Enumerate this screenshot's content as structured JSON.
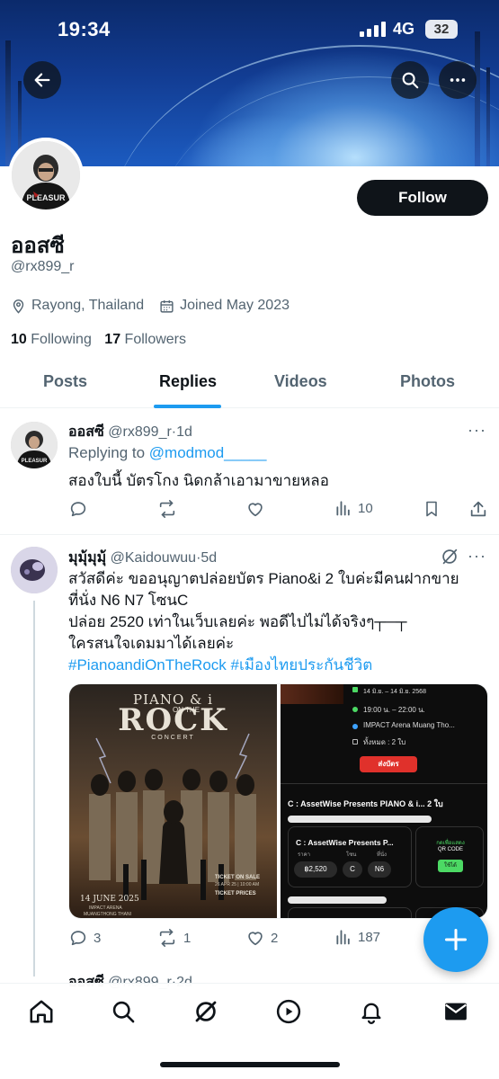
{
  "status_bar": {
    "time": "19:34",
    "network": "4G",
    "battery": "32"
  },
  "profile": {
    "display_name": "ออสซี",
    "handle": "@rx899_r",
    "location": "Rayong, Thailand",
    "joined": "Joined May 2023",
    "following_count": "10",
    "following_label": "Following",
    "followers_count": "17",
    "followers_label": "Followers",
    "follow_label": "Follow"
  },
  "tabs": [
    {
      "label": "Posts",
      "active": false
    },
    {
      "label": "Replies",
      "active": true
    },
    {
      "label": "Videos",
      "active": false
    },
    {
      "label": "Photos",
      "active": false
    }
  ],
  "posts": [
    {
      "name": "ออสซี",
      "handle": "@rx899_r",
      "time": "1d",
      "replying_prefix": "Replying to ",
      "replying_to": "@modmod_____",
      "text": "สองใบนี้ บัตรโกง นิดกล้าเอามาขายหลอ",
      "views": "10"
    },
    {
      "name": "มุมุ้มุมุ้",
      "handle": "@Kaidouwuu",
      "time": "5d",
      "lines": [
        "สวัสดีค่ะ ขออนุญาตปล่อยบัตร Piano&i 2 ใบค่ะมีคนฝากขาย",
        "ที่นั่ง N6 N7 โซนC",
        "ปล่อย 2520 เท่าในเว็บเลยค่ะ พอดีไปไม่ได้จริงๆ┬─┬",
        "ใครสนใจเดมมาได้เลยค่ะ"
      ],
      "hashtags": "#PianoandiOnTheRock #เมืองไทยประกันชีวิต",
      "replies": "3",
      "reposts": "1",
      "likes": "2",
      "views": "187",
      "poster": {
        "title_top": "PIANO & i",
        "on_the": "ON THE",
        "title_main": "ROCK",
        "concert": "CONCERT",
        "date": "14 JUNE 2025",
        "venue": "IMPACT ARENA",
        "venue2": "MUANGTHONG THANI",
        "sale_title": "TICKET ON SALE",
        "sale_date": "26 APR 25 | 10:00 AM",
        "prices_title": "TICKET PRICES"
      },
      "ticket": {
        "date": "14 มิ.ย. – 14 มิ.ย. 2568",
        "time": "19:00 น. – 22:00 น.",
        "venue": "IMPACT Arena Muang Tho...",
        "total": "ทั้งหมด : 2 ใบ",
        "send_btn": "ส่งบัตร",
        "section_title": "C : AssetWise Presents PIANO & i... 2 ใบ",
        "card_title": "C : AssetWise Presents P...",
        "price_label": "ราคา",
        "zone_label": "โซน",
        "seat_label": "ที่นั่ง",
        "price": "฿2,520",
        "zone": "C",
        "seat": "N6",
        "show_label": "กดเพื่อแสดง",
        "qr_label": "QR CODE",
        "use_label": "ใช้ได้"
      }
    }
  ],
  "peek": {
    "name": "ออสซี",
    "handle": "@rx899_r",
    "time": "2d"
  },
  "colors": {
    "accent": "#1d9bf0",
    "text": "#0f1419",
    "muted": "#536471"
  },
  "icons": [
    "back-arrow-icon",
    "search-icon",
    "more-icon",
    "location-icon",
    "calendar-icon",
    "reply-icon",
    "repost-icon",
    "like-icon",
    "views-icon",
    "bookmark-icon",
    "share-icon",
    "grok-icon",
    "plus-icon",
    "home-icon",
    "notifications-icon",
    "messages-icon",
    "video-icon"
  ]
}
